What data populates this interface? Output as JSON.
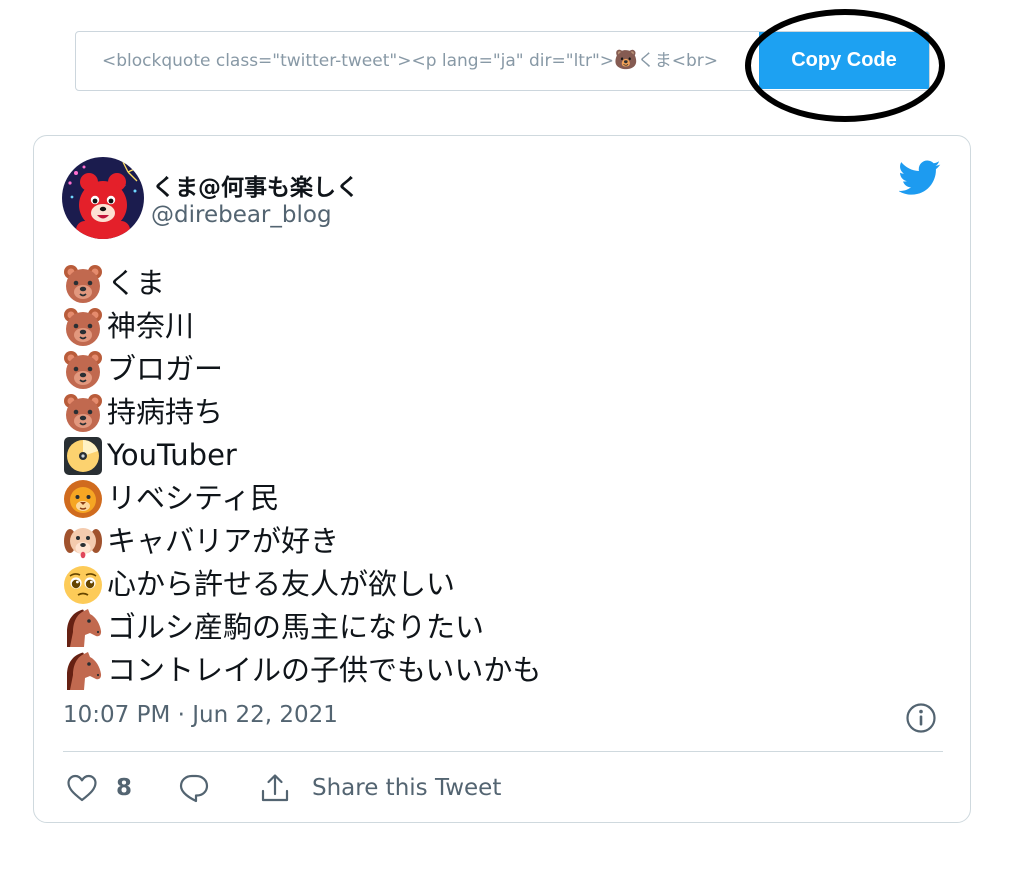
{
  "embed": {
    "code_before": "<blockquote class=\"twitter-tweet\"><p lang=\"ja\" dir=\"ltr\">",
    "code_emoji": "🐻",
    "code_after": "くま<br>",
    "copy_button_label": "Copy Code"
  },
  "tweet": {
    "display_name": "くま@何事も楽しく",
    "handle": "@direbear_blog",
    "lines": [
      {
        "icon": "bear-icon",
        "text": "くま"
      },
      {
        "icon": "bear-icon",
        "text": "神奈川"
      },
      {
        "icon": "bear-icon",
        "text": "ブロガー"
      },
      {
        "icon": "bear-icon",
        "text": "持病持ち"
      },
      {
        "icon": "dvd-icon",
        "text": "YouTuber"
      },
      {
        "icon": "lion-icon",
        "text": "リベシティ民"
      },
      {
        "icon": "dog-icon",
        "text": "キャバリアが好き"
      },
      {
        "icon": "pleading-face-icon",
        "text": "心から許せる友人が欲しい"
      },
      {
        "icon": "horse-icon",
        "text": "ゴルシ産駒の馬主になりたい"
      },
      {
        "icon": "horse-icon",
        "text": "コントレイルの子供でもいいかも"
      }
    ],
    "timestamp": "10:07 PM · Jun 22, 2021",
    "like_count": "8",
    "share_label": "Share this Tweet"
  },
  "colors": {
    "accent": "#1da1f2",
    "muted_text": "#536471",
    "code_text": "#8899a6",
    "border": "#cfd9de",
    "highlight_ring": "#000000"
  }
}
